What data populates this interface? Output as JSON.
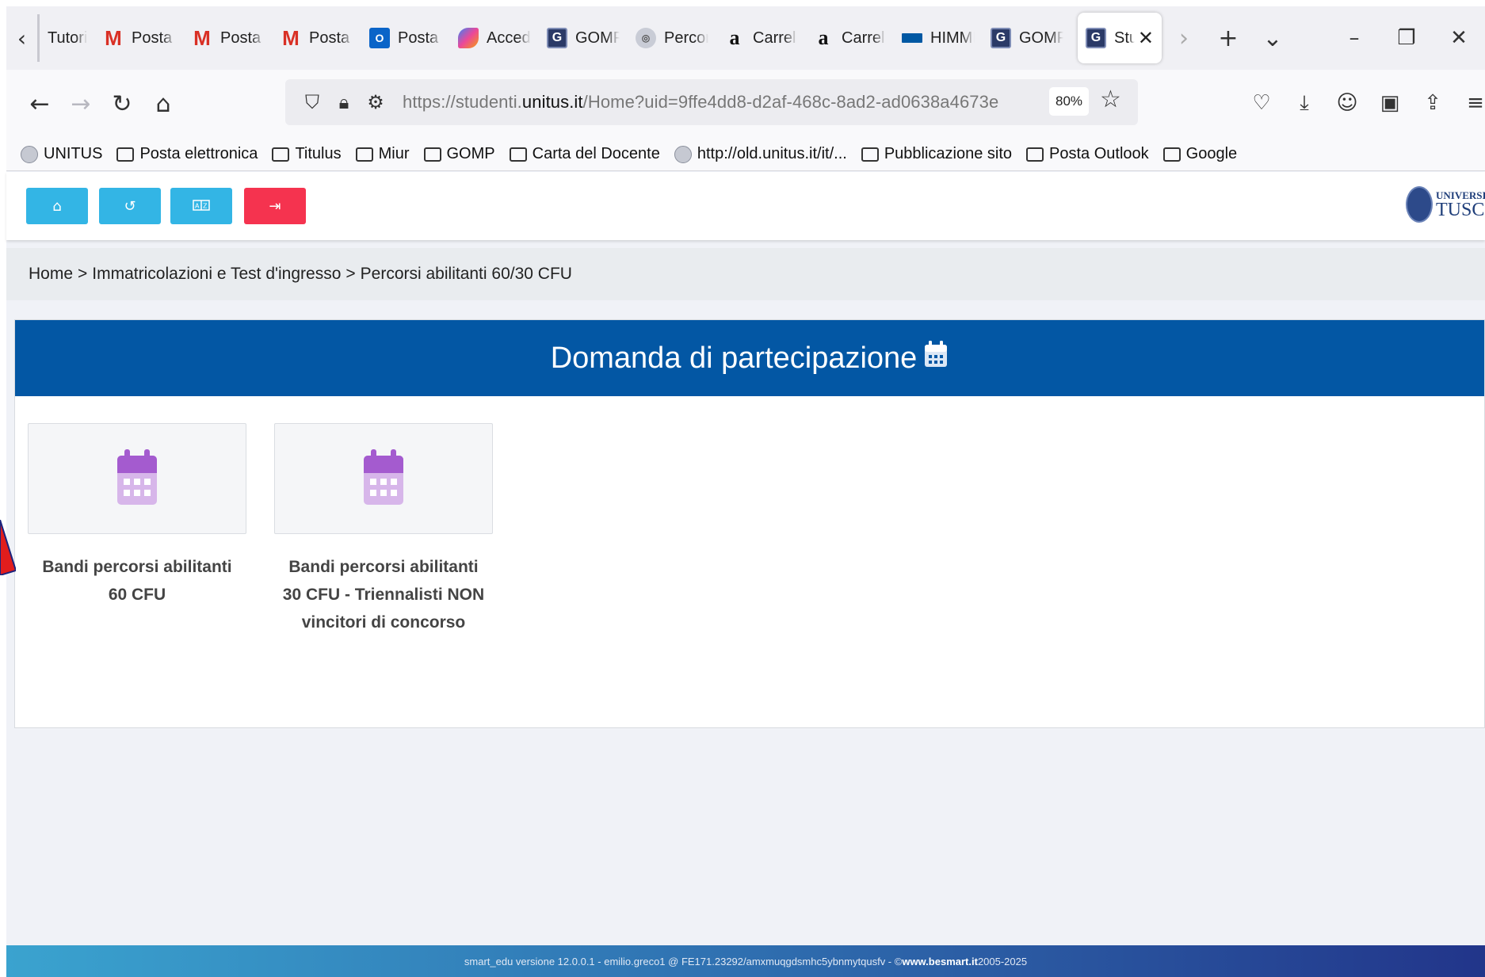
{
  "browser": {
    "tabs": [
      {
        "label": "Tutoria",
        "icon": "none"
      },
      {
        "label": "Posta i",
        "icon": "gmail-icon"
      },
      {
        "label": "Posta i",
        "icon": "gmail-icon"
      },
      {
        "label": "Posta i",
        "icon": "gmail-icon"
      },
      {
        "label": "Posta -",
        "icon": "outlook-icon"
      },
      {
        "label": "Accedi",
        "icon": "copilot-icon"
      },
      {
        "label": "GOMP",
        "icon": "gomp-icon"
      },
      {
        "label": "Percor",
        "icon": "unitus-seal-icon"
      },
      {
        "label": "Carrell",
        "icon": "amazon-icon"
      },
      {
        "label": "Carrell",
        "icon": "amazon-icon"
      },
      {
        "label": "HIMMI",
        "icon": "ikea-icon"
      },
      {
        "label": "GOMP",
        "icon": "gomp-icon"
      }
    ],
    "active_tab": {
      "label": "Stuc",
      "icon": "gomp-icon"
    },
    "url_prefix": "https://studenti.",
    "url_domain": "unitus.it",
    "url_path": "/Home?uid=9ffe4dd8-d2af-468c-8ad2-ad0638a4673e",
    "zoom": "80%",
    "bookmarks": [
      {
        "label": "UNITUS",
        "icon": "unitus-seal-icon"
      },
      {
        "label": "Posta elettronica",
        "icon": "folder-icon"
      },
      {
        "label": "Titulus",
        "icon": "folder-icon"
      },
      {
        "label": "Miur",
        "icon": "folder-icon"
      },
      {
        "label": "GOMP",
        "icon": "folder-icon"
      },
      {
        "label": "Carta del Docente",
        "icon": "folder-icon"
      },
      {
        "label": "http://old.unitus.it/it/...",
        "icon": "unitus-seal-icon"
      },
      {
        "label": "Pubblicazione sito",
        "icon": "folder-icon"
      },
      {
        "label": "Posta Outlook",
        "icon": "folder-icon"
      },
      {
        "label": "Google",
        "icon": "folder-icon"
      }
    ]
  },
  "header": {
    "logo_line1": "UNIVERSITÀ",
    "logo_line2": "TUSCIA",
    "buttons": [
      {
        "icon": "home-icon",
        "color": "#33b5e5"
      },
      {
        "icon": "history-icon",
        "color": "#33b5e5"
      },
      {
        "icon": "language-icon",
        "color": "#33b5e5"
      },
      {
        "icon": "logout-icon",
        "color": "#f5334f"
      }
    ]
  },
  "breadcrumb": {
    "items": [
      "Home",
      "Immatricolazioni e Test d'ingresso",
      "Percorsi abilitanti 60/30 CFU"
    ],
    "separator": ">"
  },
  "main": {
    "title": "Domanda di partecipazione",
    "cards": [
      {
        "label": "Bandi percorsi abilitanti 60 CFU",
        "icon": "calendar-icon"
      },
      {
        "label": "Bandi percorsi abilitanti 30 CFU - Triennalisti NON vincitori di concorso",
        "icon": "calendar-icon"
      }
    ]
  },
  "footer": {
    "text": "smart_edu versione 12.0.0.1 - emilio.greco1 @ FE171.23292/amxmuqgdsmhc5ybnmytqusfv - © ",
    "link": "www.besmart.it",
    "years": " 2005-2025"
  },
  "colors": {
    "header_blue": "#0357a4",
    "accent_cyan": "#33b5e5",
    "logout_red": "#f5334f",
    "calendar_purple": "#a45bcf"
  }
}
